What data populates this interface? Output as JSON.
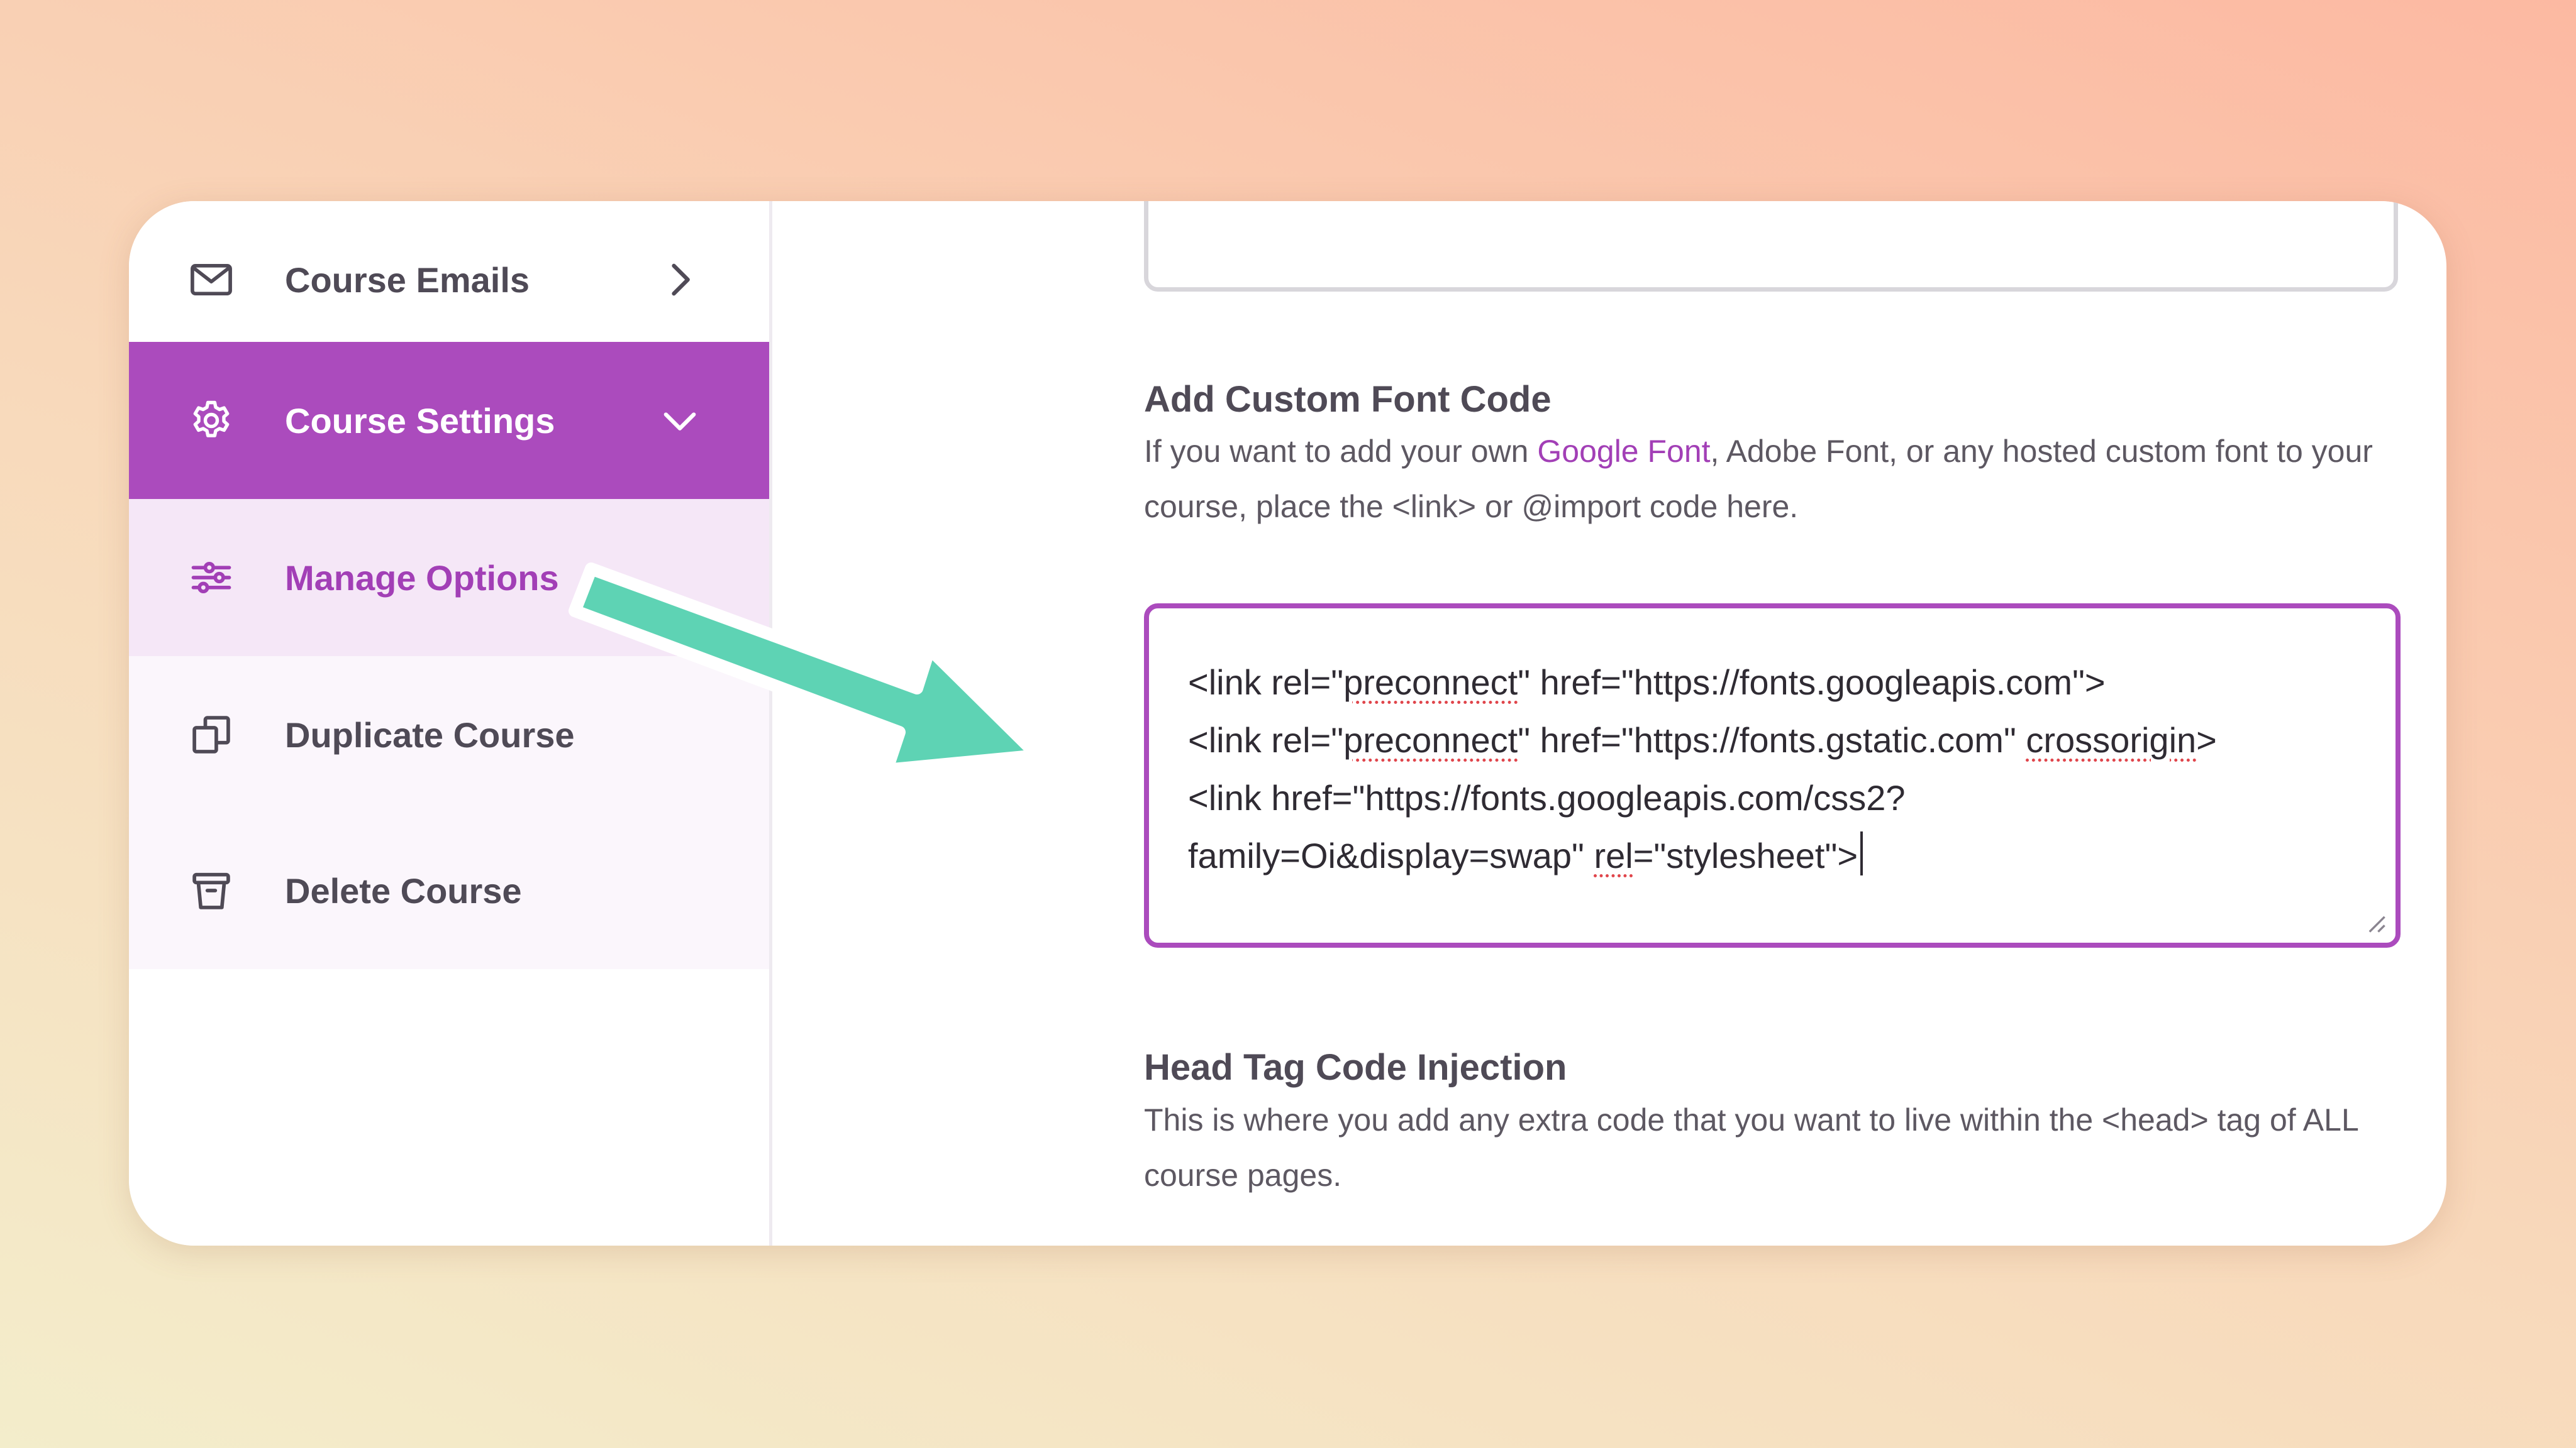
{
  "sidebar": {
    "items": [
      {
        "label": "Course Emails",
        "icon": "mail-icon"
      },
      {
        "label": "Course Settings",
        "icon": "gear-icon"
      },
      {
        "label": "Manage Options",
        "icon": "sliders-icon"
      },
      {
        "label": "Duplicate Course",
        "icon": "duplicate-icon"
      },
      {
        "label": "Delete Course",
        "icon": "trash-icon"
      }
    ]
  },
  "custom_font": {
    "heading": "Add Custom Font Code",
    "desc_before": "If you want to add your own ",
    "desc_link": "Google Font",
    "desc_after": ", Adobe Font, or any hosted custom font to your course, place the <link> or @import code here.",
    "code": {
      "l1_a": "<link rel=\"",
      "l1_b": "preconnect",
      "l1_c": "\" href=\"https://fonts.googleapis.com\">",
      "l2_a": "<link rel=\"",
      "l2_b": "preconnect",
      "l2_c": "\" href=\"https://fonts.gstatic.com\" ",
      "l2_d": "crossorigin",
      "l2_e": ">",
      "l3": "<link href=\"https://fonts.googleapis.com/css2?",
      "l4_a": "family=Oi&display=swap\" ",
      "l4_b": "rel",
      "l4_c": "=\"stylesheet\">"
    }
  },
  "head_tag": {
    "heading": "Head Tag Code Injection",
    "desc": "This is where you add any extra code that you want to live within the <head> tag of ALL course pages."
  },
  "colors": {
    "accent": "#ab4bbd",
    "arrow": "#5ed3b4"
  }
}
